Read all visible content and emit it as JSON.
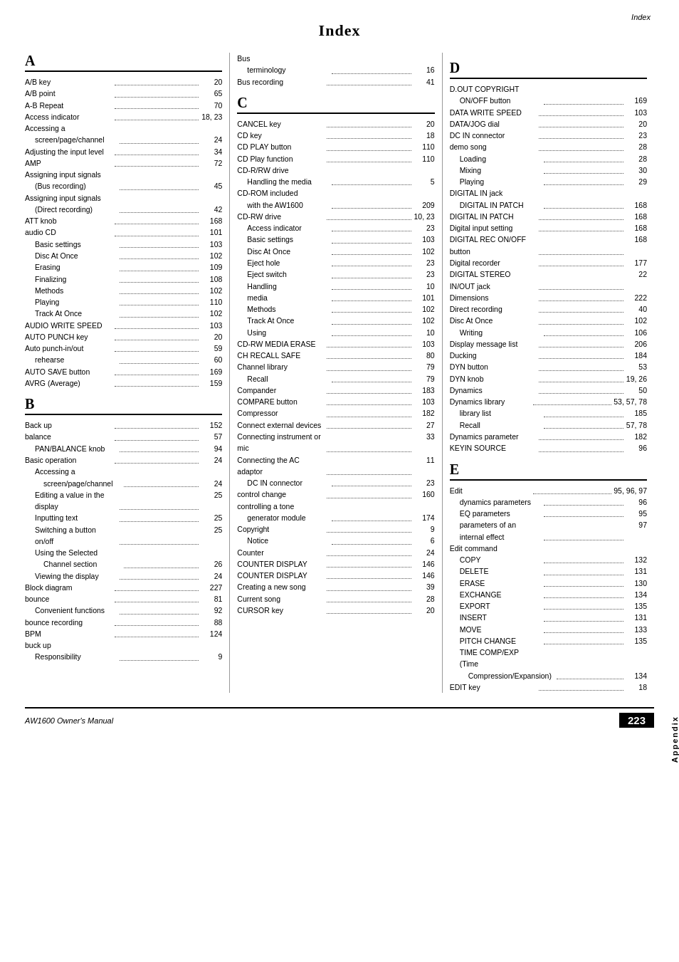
{
  "header": {
    "label": "Index",
    "title": "Index"
  },
  "sections": {
    "A": {
      "letter": "A"
    },
    "B": {
      "letter": "B"
    },
    "C": {
      "letter": "C"
    },
    "D": {
      "letter": "D"
    },
    "E": {
      "letter": "E"
    }
  },
  "footer": {
    "model": "AW1600 Owner's Manual",
    "page": "223",
    "appendix": "Appendix"
  }
}
